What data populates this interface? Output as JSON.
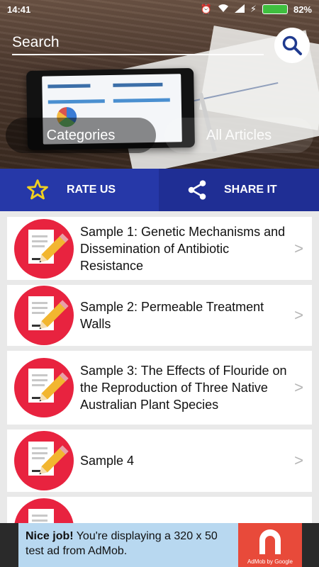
{
  "status_bar": {
    "time": "14:41",
    "battery_percent": "82%",
    "battery_level": 0.82
  },
  "search": {
    "placeholder": "Search"
  },
  "nav_pills": {
    "categories": "Categories",
    "all_articles": "All Articles"
  },
  "actions": {
    "rate_label": "RATE US",
    "share_label": "SHARE IT"
  },
  "articles": [
    {
      "title": "Sample 1: Genetic Mechanisms and Dissemination of Antibiotic Resistance"
    },
    {
      "title": "Sample 2: Permeable Treatment Walls"
    },
    {
      "title": "Sample 3: The Effects of Flouride on the Reproduction of Three Native Australian Plant Species"
    },
    {
      "title": "Sample 4"
    },
    {
      "title": ""
    }
  ],
  "ad": {
    "headline": "Nice job!",
    "body": " You're displaying a 320 x 50 test ad from AdMob.",
    "logo_caption": "AdMob by Google"
  },
  "colors": {
    "action_rate_bg": "#2638a8",
    "action_share_bg": "#1f2e94",
    "star": "#f0d020",
    "icon_circle": "#e8233f",
    "search_icon": "#1f3a8f",
    "ad_bg": "#b8d8f0",
    "ad_logo_bg": "#e84a3a"
  }
}
